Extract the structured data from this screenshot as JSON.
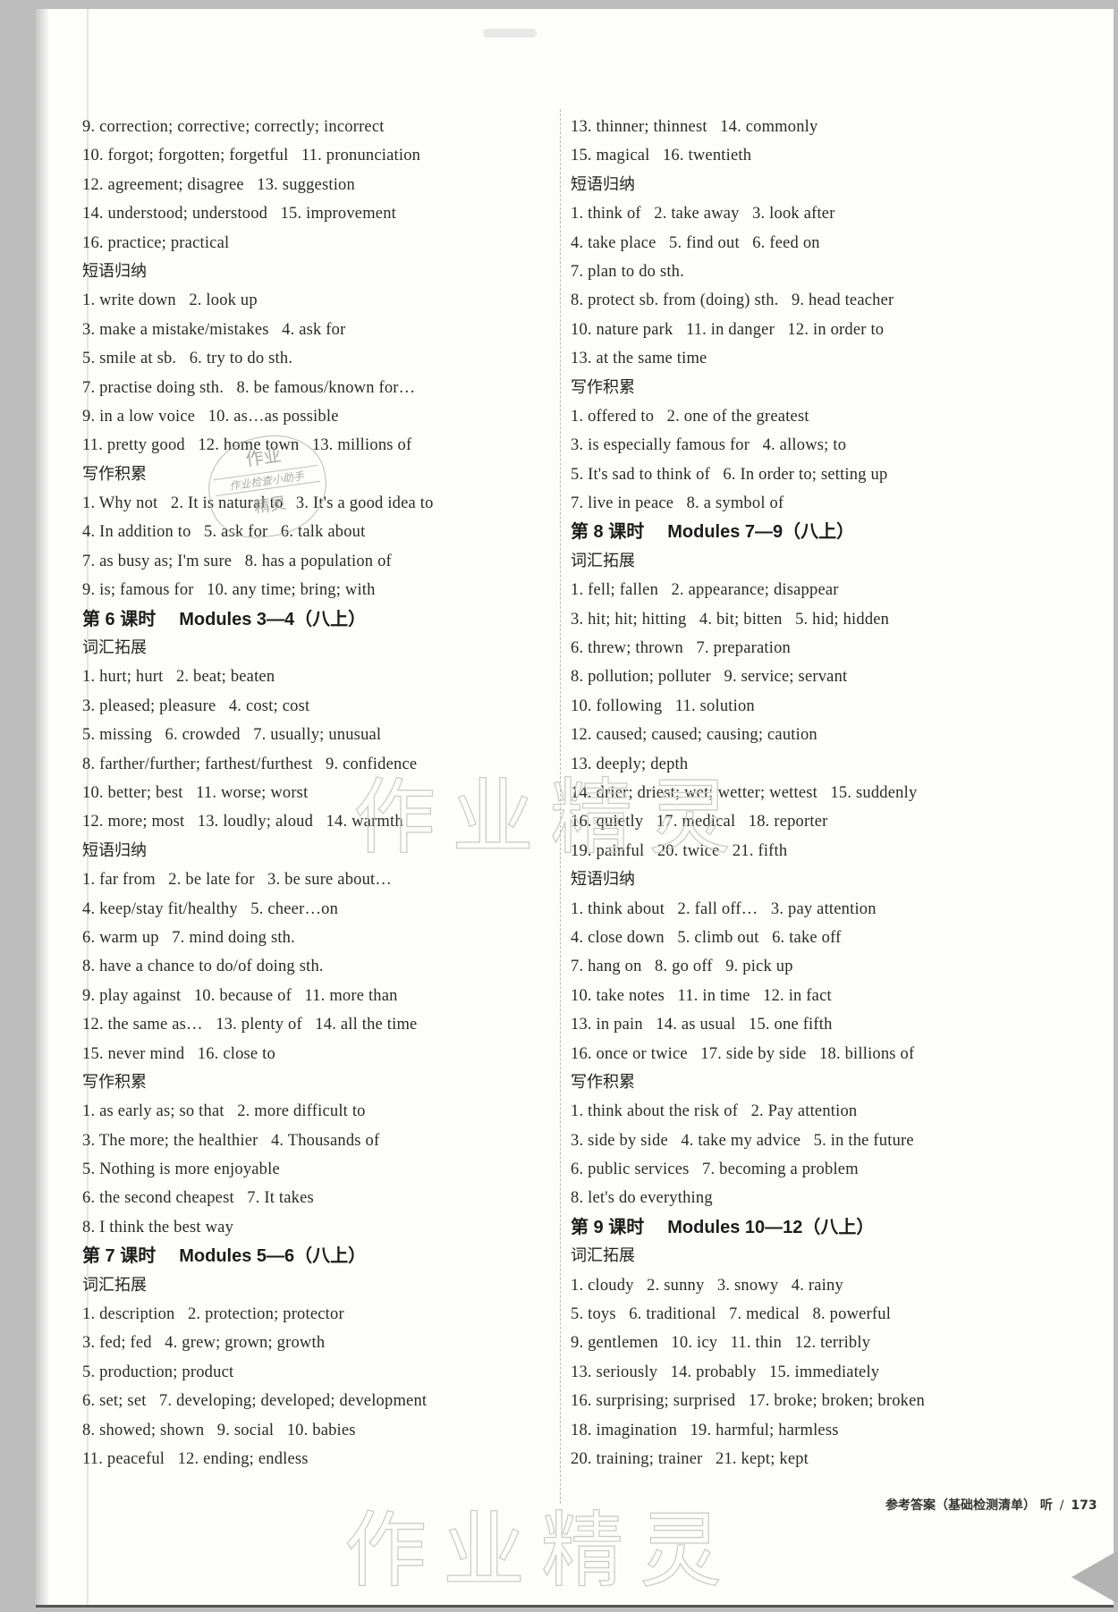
{
  "left_column": [
    {
      "type": "line",
      "text": "9. correction; corrective; correctly; incorrect"
    },
    {
      "type": "line",
      "text": "10. forgot; forgotten; forgetful   11. pronunciation"
    },
    {
      "type": "line",
      "text": "12. agreement; disagree   13. suggestion"
    },
    {
      "type": "line",
      "text": "14. understood; understood   15. improvement"
    },
    {
      "type": "line",
      "text": "16. practice; practical"
    },
    {
      "type": "sub",
      "text": "短语归纳"
    },
    {
      "type": "line",
      "text": "1. write down   2. look up"
    },
    {
      "type": "line",
      "text": "3. make a mistake/mistakes   4. ask for"
    },
    {
      "type": "line",
      "text": "5. smile at sb.   6. try to do sth."
    },
    {
      "type": "line",
      "text": "7. practise doing sth.   8. be famous/known for…"
    },
    {
      "type": "line",
      "text": "9. in a low voice   10. as…as possible"
    },
    {
      "type": "line",
      "text": "11. pretty good   12. home town   13. millions of"
    },
    {
      "type": "sub",
      "text": "写作积累"
    },
    {
      "type": "line",
      "text": "1. Why not   2. It is natural to   3. It's a good idea to"
    },
    {
      "type": "line",
      "text": "4. In addition to   5. ask for   6. talk about"
    },
    {
      "type": "line",
      "text": "7. as busy as; I'm sure   8. has a population of"
    },
    {
      "type": "line",
      "text": "9. is; famous for   10. any time; bring; with"
    },
    {
      "type": "lesson",
      "num": "第 6 课时",
      "title": "Modules 3—4（八上）"
    },
    {
      "type": "sub",
      "text": "词汇拓展"
    },
    {
      "type": "line",
      "text": "1. hurt; hurt   2. beat; beaten"
    },
    {
      "type": "line",
      "text": "3. pleased; pleasure   4. cost; cost"
    },
    {
      "type": "line",
      "text": "5. missing   6. crowded   7. usually; unusual"
    },
    {
      "type": "line",
      "text": "8. farther/further; farthest/furthest   9. confidence"
    },
    {
      "type": "line",
      "text": "10. better; best   11. worse; worst"
    },
    {
      "type": "line",
      "text": "12. more; most   13. loudly; aloud   14. warmth"
    },
    {
      "type": "sub",
      "text": "短语归纳"
    },
    {
      "type": "line",
      "text": "1. far from   2. be late for   3. be sure about…"
    },
    {
      "type": "line",
      "text": "4. keep/stay fit/healthy   5. cheer…on"
    },
    {
      "type": "line",
      "text": "6. warm up   7. mind doing sth."
    },
    {
      "type": "line",
      "text": "8. have a chance to do/of doing sth."
    },
    {
      "type": "line",
      "text": "9. play against   10. because of   11. more than"
    },
    {
      "type": "line",
      "text": "12. the same as…   13. plenty of   14. all the time"
    },
    {
      "type": "line",
      "text": "15. never mind   16. close to"
    },
    {
      "type": "sub",
      "text": "写作积累"
    },
    {
      "type": "line",
      "text": "1. as early as; so that   2. more difficult to"
    },
    {
      "type": "line",
      "text": "3. The more; the healthier   4. Thousands of"
    },
    {
      "type": "line",
      "text": "5. Nothing is more enjoyable"
    },
    {
      "type": "line",
      "text": "6. the second cheapest   7. It takes"
    },
    {
      "type": "line",
      "text": "8. I think the best way"
    },
    {
      "type": "lesson",
      "num": "第 7 课时",
      "title": "Modules 5—6（八上）"
    },
    {
      "type": "sub",
      "text": "词汇拓展"
    },
    {
      "type": "line",
      "text": "1. description   2. protection; protector"
    },
    {
      "type": "line",
      "text": "3. fed; fed   4. grew; grown; growth"
    },
    {
      "type": "line",
      "text": "5. production; product"
    },
    {
      "type": "line",
      "text": "6. set; set   7. developing; developed; development"
    },
    {
      "type": "line",
      "text": "8. showed; shown   9. social   10. babies"
    },
    {
      "type": "line",
      "text": "11. peaceful   12. ending; endless"
    }
  ],
  "right_column": [
    {
      "type": "line",
      "text": "13. thinner; thinnest   14. commonly"
    },
    {
      "type": "line",
      "text": "15. magical   16. twentieth"
    },
    {
      "type": "sub",
      "text": "短语归纳"
    },
    {
      "type": "line",
      "text": "1. think of   2. take away   3. look after"
    },
    {
      "type": "line",
      "text": "4. take place   5. find out   6. feed on"
    },
    {
      "type": "line",
      "text": "7. plan to do sth."
    },
    {
      "type": "line",
      "text": "8. protect sb. from (doing) sth.   9. head teacher"
    },
    {
      "type": "line",
      "text": "10. nature park   11. in danger   12. in order to"
    },
    {
      "type": "line",
      "text": "13. at the same time"
    },
    {
      "type": "sub",
      "text": "写作积累"
    },
    {
      "type": "line",
      "text": "1. offered to   2. one of the greatest"
    },
    {
      "type": "line",
      "text": "3. is especially famous for   4. allows; to"
    },
    {
      "type": "line",
      "text": "5. It's sad to think of   6. In order to; setting up"
    },
    {
      "type": "line",
      "text": "7. live in peace   8. a symbol of"
    },
    {
      "type": "lesson",
      "num": "第 8 课时",
      "title": "Modules 7—9（八上）"
    },
    {
      "type": "sub",
      "text": "词汇拓展"
    },
    {
      "type": "line",
      "text": "1. fell; fallen   2. appearance; disappear"
    },
    {
      "type": "line",
      "text": "3. hit; hit; hitting   4. bit; bitten   5. hid; hidden"
    },
    {
      "type": "line",
      "text": "6. threw; thrown   7. preparation"
    },
    {
      "type": "line",
      "text": "8. pollution; polluter   9. service; servant"
    },
    {
      "type": "line",
      "text": "10. following   11. solution"
    },
    {
      "type": "line",
      "text": "12. caused; caused; causing; caution"
    },
    {
      "type": "line",
      "text": "13. deeply; depth"
    },
    {
      "type": "line",
      "text": "14. drier; driest; wet; wetter; wettest   15. suddenly"
    },
    {
      "type": "line",
      "text": "16. quietly   17. medical   18. reporter"
    },
    {
      "type": "line",
      "text": "19. painful   20. twice   21. fifth"
    },
    {
      "type": "sub",
      "text": "短语归纳"
    },
    {
      "type": "line",
      "text": "1. think about   2. fall off…   3. pay attention"
    },
    {
      "type": "line",
      "text": "4. close down   5. climb out   6. take off"
    },
    {
      "type": "line",
      "text": "7. hang on   8. go off   9. pick up"
    },
    {
      "type": "line",
      "text": "10. take notes   11. in time   12. in fact"
    },
    {
      "type": "line",
      "text": "13. in pain   14. as usual   15. one fifth"
    },
    {
      "type": "line",
      "text": "16. once or twice   17. side by side   18. billions of"
    },
    {
      "type": "sub",
      "text": "写作积累"
    },
    {
      "type": "line",
      "text": "1. think about the risk of   2. Pay attention"
    },
    {
      "type": "line",
      "text": "3. side by side   4. take my advice   5. in the future"
    },
    {
      "type": "line",
      "text": "6. public services   7. becoming a problem"
    },
    {
      "type": "line",
      "text": "8. let's do everything"
    },
    {
      "type": "lesson",
      "num": "第 9 课时",
      "title": "Modules 10—12（八上）"
    },
    {
      "type": "sub",
      "text": "词汇拓展"
    },
    {
      "type": "line",
      "text": "1. cloudy   2. sunny   3. snowy   4. rainy"
    },
    {
      "type": "line",
      "text": "5. toys   6. traditional   7. medical   8. powerful"
    },
    {
      "type": "line",
      "text": "9. gentlemen   10. icy   11. thin   12. terribly"
    },
    {
      "type": "line",
      "text": "13. seriously   14. probably   15. immediately"
    },
    {
      "type": "line",
      "text": "16. surprising; surprised   17. broke; broken; broken"
    },
    {
      "type": "line",
      "text": "18. imagination   19. harmful; harmless"
    },
    {
      "type": "line",
      "text": "20. training; trainer   21. kept; kept"
    }
  ],
  "footer": {
    "label": "参考答案（基础检测清单）",
    "subject": "听",
    "separator": "/",
    "page_number": "173"
  },
  "watermarks": {
    "stamp_top": "作业",
    "stamp_middle": "作业检查小助手",
    "stamp_bottom": "精灵",
    "large_text": "作业精灵"
  },
  "icons": {
    "page_turn": "page-turn-triangle-icon"
  }
}
